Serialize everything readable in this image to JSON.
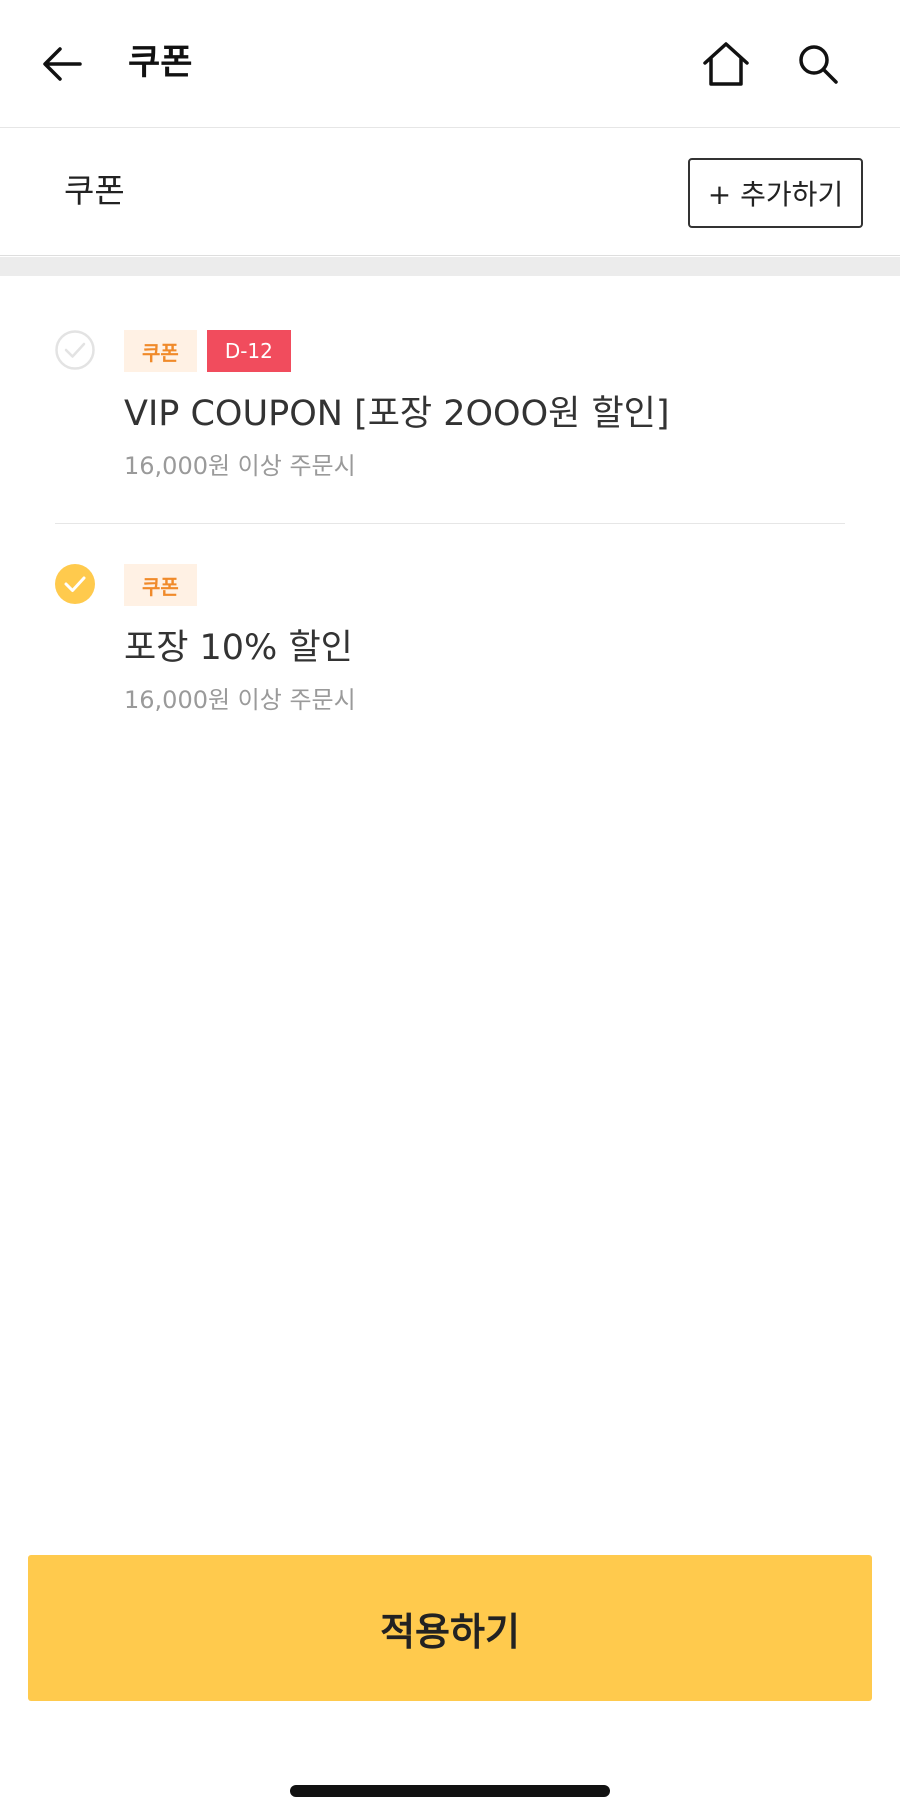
{
  "header": {
    "title": "쿠폰",
    "back_icon": "arrow-left-icon",
    "home_icon": "home-icon",
    "search_icon": "search-icon"
  },
  "section": {
    "title": "쿠폰",
    "add_label": "+ 추가하기"
  },
  "coupons": [
    {
      "tag": "쿠폰",
      "dday": "D-12",
      "name": "VIP COUPON [포장 2OOO원 할인]",
      "condition": "16,000원 이상 주문시",
      "selected": false
    },
    {
      "tag": "쿠폰",
      "name": "포장 10% 할인",
      "condition": "16,000원 이상 주문시",
      "selected": true
    }
  ],
  "apply_label": "적용하기",
  "colors": {
    "accent": "#ffca4d",
    "tag_bg": "#fff1e4",
    "tag_text": "#f08a2a",
    "dday_bg": "#f14c5d",
    "check_unselected": "#e3e3e3"
  }
}
